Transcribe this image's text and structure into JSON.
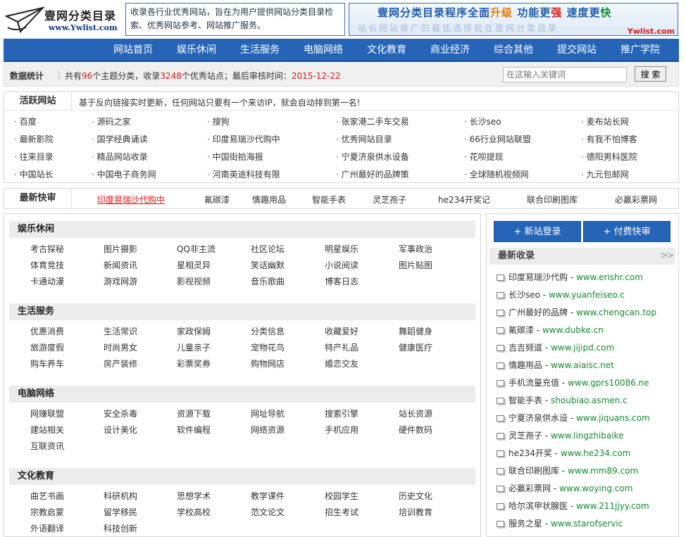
{
  "logo": {
    "title": "壹网分类目录",
    "url": "www.Ywlist.com"
  },
  "intro": "收录各行业优秀网站，旨在为用户提供网站分类目录检索、优秀网站参考、网站推广服务。",
  "banner": {
    "line1_a": "壹网分类目录程序全面",
    "line1_b": "升级",
    "line1_c": "功能更",
    "line1_d": "强",
    "line1_e": "速度更",
    "line1_f": "快",
    "line2": "站长网站推广的最佳选择就在壹网分类目录",
    "site": "Ywlist.com"
  },
  "nav": [
    "网站首页",
    "娱乐休闲",
    "生活服务",
    "电脑网络",
    "文化教育",
    "商业经济",
    "综合其他",
    "提交网站",
    "推广学院"
  ],
  "stats": {
    "title": "数据统计",
    "sep": "|",
    "p1": "共有",
    "topics": "96",
    "p2": "个主题分类，收录",
    "sites": "3248",
    "p3": "个优秀站点；最后审核时间：",
    "date": "2015-12-22",
    "search_placeholder": "在这输入关键词",
    "search_button": "搜 索"
  },
  "active": {
    "title": "活跃网站",
    "desc": "基于反向链接实时更新，任何网站只要有一个来访IP，就会自动排到第一名!",
    "rows": [
      [
        "百度",
        "源码之家",
        "搜狗",
        "张家港二手车交易",
        "长沙seo",
        "麦布站长网"
      ],
      [
        "最新影院",
        "国学经典诵读",
        "印度易瑞沙代购中",
        "优秀网站目录",
        "66行业网站联盟",
        "有我不怕博客"
      ],
      [
        "往来目录",
        "精品网站收录",
        "中国街拍海报",
        "宁夏济泉供水设备",
        "花呗提现",
        "德阳男科医院"
      ],
      [
        "中国站长",
        "中国电子商务网",
        "河南英途科技有限",
        "广州最好的品牌策",
        "全球随机视频网",
        "九元包邮网"
      ]
    ]
  },
  "quick": {
    "title": "最新快审",
    "items": [
      "印度易瑞沙代购中",
      "氟碳漆",
      "情趣用品",
      "智能手表",
      "灵芝孢子",
      "he234开奖记",
      "联合印刷图库",
      "必赢彩票网"
    ]
  },
  "categories": [
    {
      "name": "娱乐休闲",
      "links": [
        "考古探秘",
        "图片摄影",
        "QQ非主流",
        "社区论坛",
        "明星娱乐",
        "军事政治",
        "体育竞技",
        "新闻资讯",
        "星相灵异",
        "笑话幽默",
        "小说阅读",
        "图片贴图",
        "卡通动漫",
        "游戏网游",
        "影视视频",
        "音乐歌曲",
        "博客日志"
      ]
    },
    {
      "name": "生活服务",
      "links": [
        "优惠消费",
        "生活常识",
        "家政保姆",
        "分类信息",
        "收藏爱好",
        "舞蹈健身",
        "旅游度假",
        "时尚男女",
        "儿童亲子",
        "宠物花鸟",
        "特产礼品",
        "健康医疗",
        "购车养车",
        "房产装修",
        "彩票奖券",
        "购物网店",
        "婚恋交友"
      ]
    },
    {
      "name": "电脑网络",
      "links": [
        "网赚联盟",
        "安全杀毒",
        "资源下载",
        "网址导航",
        "搜索引擎",
        "站长资源",
        "建站相关",
        "设计美化",
        "软件编程",
        "网络资源",
        "手机应用",
        "硬件数码",
        "互联资讯"
      ]
    },
    {
      "name": "文化教育",
      "links": [
        "曲艺书画",
        "科研机构",
        "思想学术",
        "教学课件",
        "校园学生",
        "历史文化",
        "宗教启蒙",
        "留学移民",
        "学校高校",
        "范文论文",
        "招生考试",
        "培训教育",
        "外语翻译",
        "科技创新"
      ]
    }
  ],
  "side": {
    "btn1": "+ 新站登录",
    "btn2": "+ 付费快审",
    "list_title": "最新收录",
    "more": ">>",
    "items": [
      {
        "name": "印度易瑞沙代购",
        "url": "www.erishr.com"
      },
      {
        "name": "长沙seo",
        "url": "www.yuanfeiseo.c"
      },
      {
        "name": "广州最好的品牌",
        "url": "www.chengcan.top"
      },
      {
        "name": "氟碳漆",
        "url": "www.dubke.cn"
      },
      {
        "name": "吉吉频道",
        "url": "www.jijipd.com"
      },
      {
        "name": "情趣用品",
        "url": "www.aiaisc.net"
      },
      {
        "name": "手机流量充值",
        "url": "www.gprs10086.ne"
      },
      {
        "name": "智能手表",
        "url": "shoubiao.asmen.c"
      },
      {
        "name": "宁夏济泉供水设",
        "url": "www.jiquans.com"
      },
      {
        "name": "灵芝孢子",
        "url": "www.lingzhibaike"
      },
      {
        "name": "he234开奖",
        "url": "www.he234.com"
      },
      {
        "name": "联合印刷图库",
        "url": "www.mm89.com"
      },
      {
        "name": "必赢彩票网",
        "url": "www.woying.com"
      },
      {
        "name": "哈尔滨甲状腺医",
        "url": "www.211jjyy.com"
      },
      {
        "name": "服务之星",
        "url": "www.starofservic"
      }
    ]
  }
}
